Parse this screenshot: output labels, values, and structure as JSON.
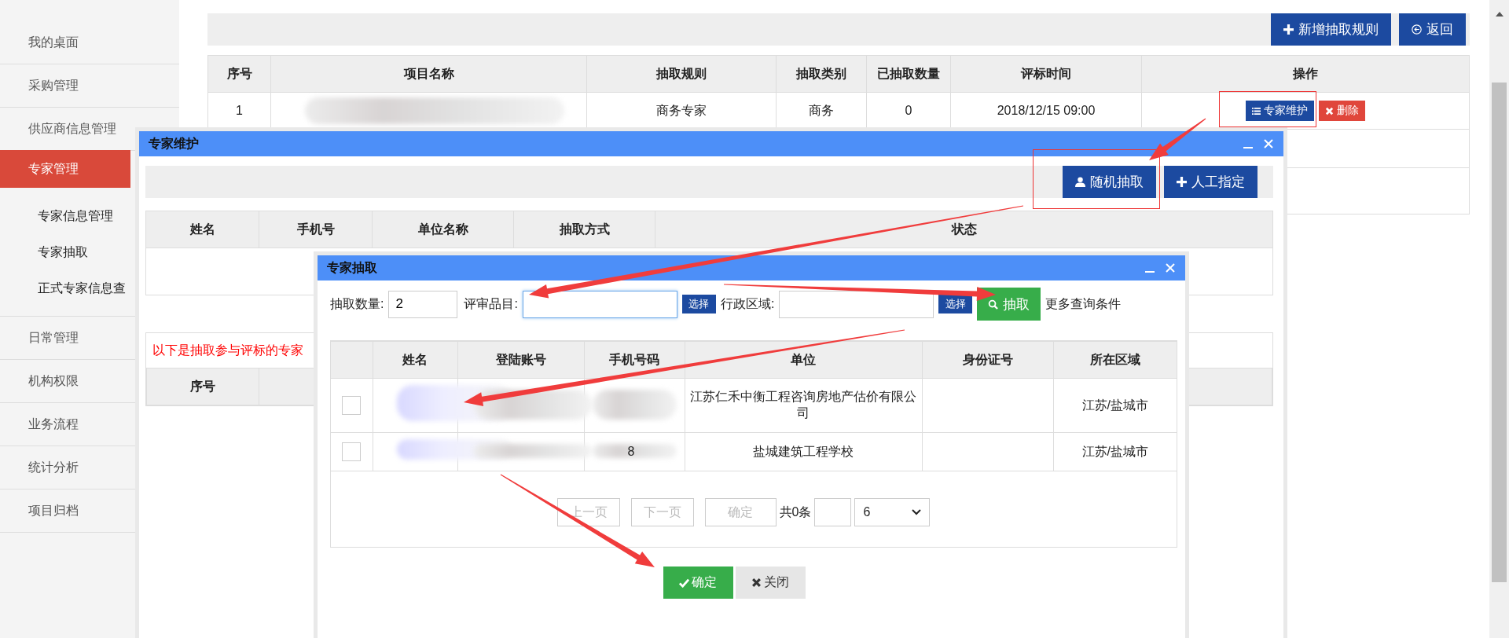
{
  "sidebar": {
    "items": [
      {
        "label": "我的桌面",
        "selected": false
      },
      {
        "label": "采购管理",
        "selected": false
      },
      {
        "label": "供应商信息管理",
        "selected": false
      },
      {
        "label": "专家管理",
        "selected": true,
        "children": [
          {
            "label": "专家信息管理"
          },
          {
            "label": "专家抽取"
          },
          {
            "label": "正式专家信息查"
          }
        ]
      },
      {
        "label": "日常管理",
        "selected": false
      },
      {
        "label": "机构权限",
        "selected": false
      },
      {
        "label": "业务流程",
        "selected": false
      },
      {
        "label": "统计分析",
        "selected": false
      },
      {
        "label": "项目归档",
        "selected": false
      }
    ]
  },
  "toolbar": {
    "buttons": [
      {
        "label": "新增抽取规则",
        "kind": "add"
      },
      {
        "label": "返回",
        "kind": "back"
      }
    ]
  },
  "rules_table": {
    "columns": [
      "序号",
      "项目名称",
      "抽取规则",
      "抽取类别",
      "已抽取数量",
      "评标时间",
      "操作"
    ],
    "rows": [
      {
        "index": "1",
        "rule": "商务专家",
        "category": "商务",
        "count": "0",
        "time": "2018/12/15 09:00",
        "actions": [
          {
            "label": "专家维护",
            "kind": "list"
          },
          {
            "label": "删除",
            "kind": "delete"
          }
        ]
      }
    ]
  },
  "maintenance_dialog": {
    "title": "专家维护",
    "buttons": [
      {
        "label": "随机抽取",
        "kind": "person"
      },
      {
        "label": "人工指定",
        "kind": "add"
      }
    ],
    "columns": [
      "姓名",
      "手机号",
      "单位名称",
      "抽取方式",
      "状态"
    ],
    "notice": "以下是抽取参与评标的专家",
    "result_columns": [
      "序号"
    ]
  },
  "draw_dialog": {
    "title": "专家抽取",
    "fields": [
      {
        "label": "抽取数量:",
        "value": "2",
        "focused": false
      },
      {
        "label": "评审品目:",
        "focused": true,
        "select": "选择"
      },
      {
        "label": "行政区域:",
        "focused": false,
        "select": "选择"
      }
    ],
    "search_button": "抽取",
    "more_link": "更多查询条件",
    "columns": [
      "姓名",
      "登陆账号",
      "手机号码",
      "单位",
      "身份证号",
      "所在区域"
    ],
    "rows": [
      {
        "checked": false,
        "unit": "江苏仁禾中衡工程咨询房地产估价有限公司",
        "region": "江苏/盐城市"
      },
      {
        "checked": false,
        "phone": "8",
        "unit": "盐城建筑工程学校",
        "region": "江苏/盐城市"
      }
    ],
    "pager": {
      "prev": "上一页",
      "next": "下一页",
      "go": "确定",
      "disabled": true,
      "total": "共0条",
      "page_size": "6"
    },
    "buttons": [
      {
        "label": "确定",
        "kind": "confirm"
      },
      {
        "label": "关闭",
        "kind": "close"
      }
    ]
  }
}
